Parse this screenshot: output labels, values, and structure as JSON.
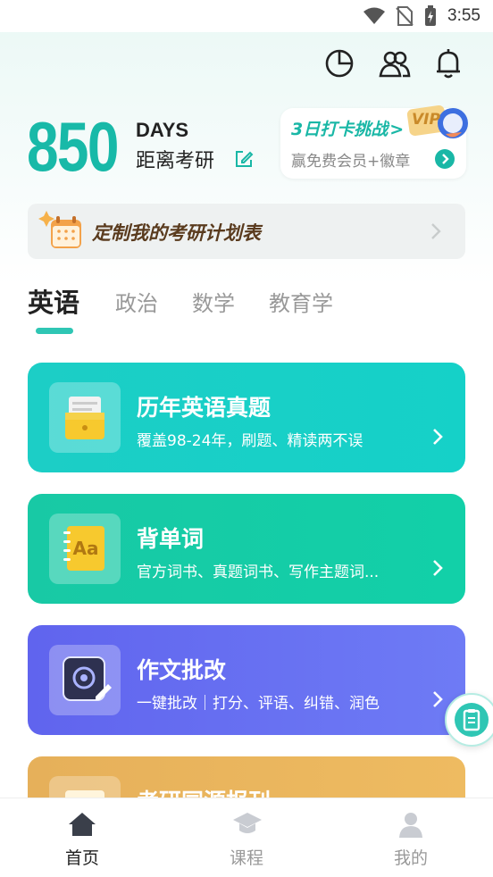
{
  "status_bar": {
    "time": "3:55"
  },
  "countdown": {
    "number": "850",
    "unit": "DAYS",
    "subtitle": "距离考研"
  },
  "challenge": {
    "title": "3日打卡挑战",
    "arrow": ">",
    "subtitle": "赢免费会员+徽章",
    "badge": "VIP"
  },
  "plan": {
    "label": "定制我的考研计划表"
  },
  "tabs": [
    {
      "label": "英语",
      "active": true
    },
    {
      "label": "政治",
      "active": false
    },
    {
      "label": "数学",
      "active": false
    },
    {
      "label": "教育学",
      "active": false
    }
  ],
  "cards": [
    {
      "title": "历年英语真题",
      "desc": "覆盖98-24年，刷题、精读两不误",
      "icon": "folder-icon"
    },
    {
      "title": "背单词",
      "desc": "官方词书、真题词书、写作主题词...",
      "icon": "notebook-aa-icon"
    },
    {
      "title": "作文批改",
      "desc": "一键批改｜打分、评语、纠错、润色",
      "icon": "ai-essay-icon"
    },
    {
      "title": "考研同源报刊",
      "desc": "",
      "icon": "newspaper-icon"
    }
  ],
  "bottom_nav": [
    {
      "label": "首页",
      "active": true
    },
    {
      "label": "课程",
      "active": false
    },
    {
      "label": "我的",
      "active": false
    }
  ],
  "colors": {
    "accent": "#18b9a8",
    "card1": "#1ccec6",
    "card2": "#18c9a5",
    "card3": "#6064ee",
    "card4": "#e6b05a"
  }
}
